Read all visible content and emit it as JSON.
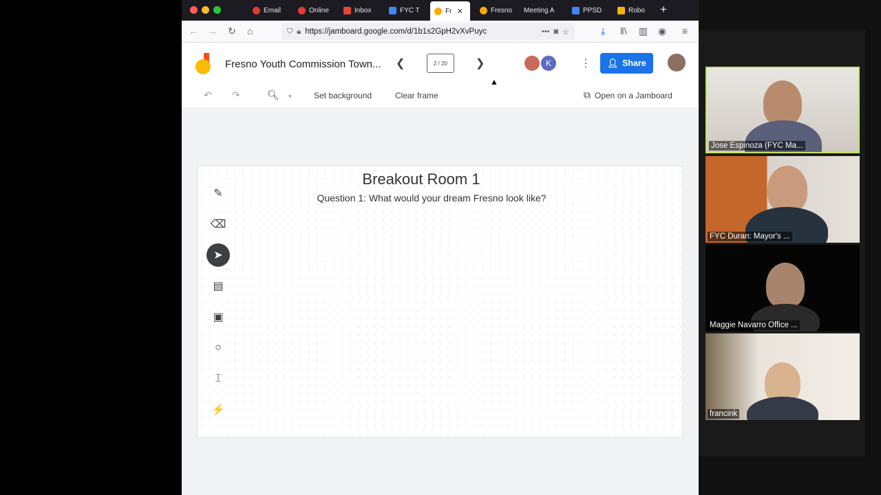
{
  "browser": {
    "tabs": [
      {
        "label": "Email",
        "icon_color": "#e53935",
        "active": false
      },
      {
        "label": "Online",
        "icon_color": "#e53935",
        "active": false
      },
      {
        "label": "Inbox",
        "icon_color": "#ea4335",
        "active": false
      },
      {
        "label": "FYC T",
        "icon_color": "#4285f4",
        "active": false
      },
      {
        "label": "Fr",
        "icon_color": "#f9ab00",
        "active": true
      },
      {
        "label": "Fresno",
        "icon_color": "#f9ab00",
        "active": false
      },
      {
        "label": "Meeting A",
        "icon_color": "#9e9e9e",
        "active": false
      },
      {
        "label": "PPSD",
        "icon_color": "#4285f4",
        "active": false
      },
      {
        "label": "Robo",
        "icon_color": "#f4b400",
        "active": false
      }
    ],
    "url": "https://jamboard.google.com/d/1b1s2GpH2vXvPuyc",
    "icons": {
      "back": "back-arrow-icon",
      "forward": "forward-arrow-icon",
      "reload": "reload-icon",
      "home": "home-icon"
    }
  },
  "jamboard": {
    "title": "Fresno Youth Commission Town...",
    "frame_counter": "2 / 20",
    "share_label": "Share",
    "collaborator_initial": "K",
    "toolbar": {
      "set_background": "Set background",
      "clear_frame": "Clear frame",
      "open_on_jamboard": "Open on a Jamboard"
    },
    "frame": {
      "title": "Breakout Room  1",
      "question": "Question 1: What would your dream Fresno look like?"
    },
    "colors": {
      "accent": "#1a73e8",
      "active_tool": "#3c4043"
    }
  },
  "participants": [
    {
      "name": "Jose Espinoza (FYC Ma...",
      "speaking": true
    },
    {
      "name": "FYC Duran: Mayor's ...",
      "speaking": false
    },
    {
      "name": "Maggie Navarro Office ...",
      "speaking": false
    },
    {
      "name": "francink",
      "speaking": false
    }
  ]
}
